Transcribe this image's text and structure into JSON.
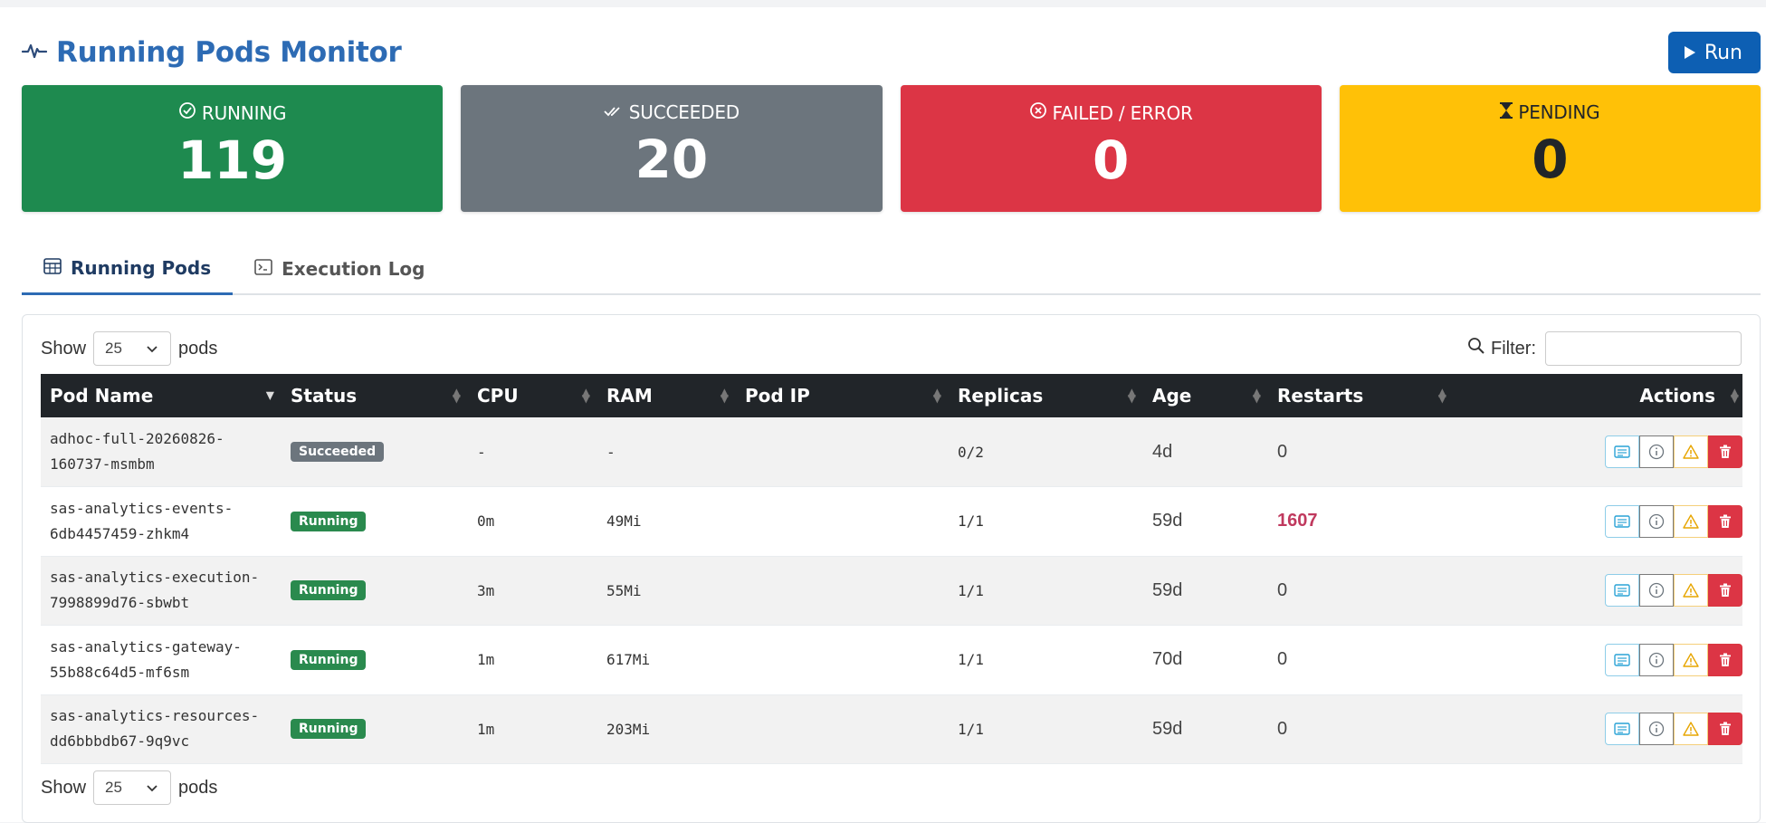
{
  "header": {
    "title": "Running Pods Monitor",
    "run_label": "Run"
  },
  "colors": {
    "running": "#1e8a4f",
    "succeeded": "#6c757d",
    "failed": "#dc3545",
    "pending": "#ffc107",
    "accent": "#2d6bb4"
  },
  "stats": [
    {
      "label": "RUNNING",
      "value": "119",
      "icon": "check-circle-icon"
    },
    {
      "label": "SUCCEEDED",
      "value": "20",
      "icon": "double-check-icon"
    },
    {
      "label": "FAILED / ERROR",
      "value": "0",
      "icon": "x-circle-icon"
    },
    {
      "label": "PENDING",
      "value": "0",
      "icon": "hourglass-icon"
    }
  ],
  "tabs": [
    {
      "label": "Running Pods",
      "icon": "table-icon",
      "active": true
    },
    {
      "label": "Execution Log",
      "icon": "terminal-icon",
      "active": false
    }
  ],
  "table_controls": {
    "show_label": "Show",
    "page_size": "25",
    "unit_label": "pods",
    "filter_label": "Filter:"
  },
  "columns": [
    "Pod Name",
    "Status",
    "CPU",
    "RAM",
    "Pod IP",
    "Replicas",
    "Age",
    "Restarts",
    "Actions"
  ],
  "rows": [
    {
      "pod_line1": "adhoc-full-20260826-",
      "pod_line2": "160737-msmbm",
      "status": "Succeeded",
      "cpu": "-",
      "ram": "-",
      "pod_ip": "",
      "replicas": "0/2",
      "age": "4d",
      "restarts": "0"
    },
    {
      "pod_line1": "sas-analytics-events-",
      "pod_line2": "6db4457459-zhkm4",
      "status": "Running",
      "cpu": "0m",
      "ram": "49Mi",
      "pod_ip": "",
      "replicas": "1/1",
      "age": "59d",
      "restarts": "1607"
    },
    {
      "pod_line1": "sas-analytics-execution-",
      "pod_line2": "7998899d76-sbwbt",
      "status": "Running",
      "cpu": "3m",
      "ram": "55Mi",
      "pod_ip": "",
      "replicas": "1/1",
      "age": "59d",
      "restarts": "0"
    },
    {
      "pod_line1": "sas-analytics-gateway-",
      "pod_line2": "55b88c64d5-mf6sm",
      "status": "Running",
      "cpu": "1m",
      "ram": "617Mi",
      "pod_ip": "",
      "replicas": "1/1",
      "age": "70d",
      "restarts": "0"
    },
    {
      "pod_line1": "sas-analytics-resources-",
      "pod_line2": "dd6bbbdb67-9q9vc",
      "status": "Running",
      "cpu": "1m",
      "ram": "203Mi",
      "pod_ip": "",
      "replicas": "1/1",
      "age": "59d",
      "restarts": "0"
    }
  ]
}
